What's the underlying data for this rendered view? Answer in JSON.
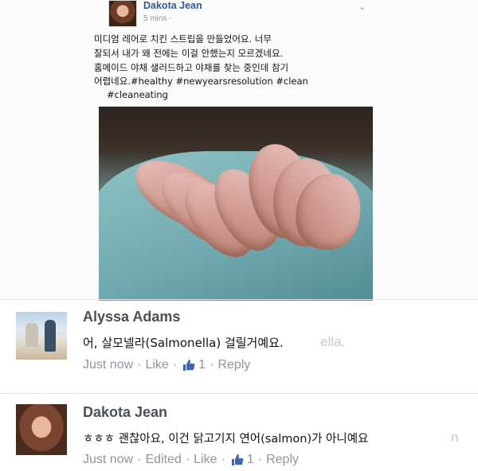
{
  "post": {
    "author": "Dakota Jean",
    "time": "5 mins ·",
    "text_line1": "미디엄 레어로 치킨 스트립을 만들었어요. 너무",
    "text_line2": "잘되서 내가 왜 전에는 이걸 안했는지 모르겠네요.",
    "text_line3": "홈메이드 야채 샐러드하고 야채를 찾는 중인데 참기",
    "text_line4": "어렵네요.#healthy #newyearsresolution #clean",
    "text_line5": "#cleaneating"
  },
  "comments": [
    {
      "name": "Alyssa Adams",
      "text": "어, 살모넬라(Salmonella) 걸릴거예요.",
      "ghost": "ella.",
      "time": "Just now",
      "like": "Like",
      "like_count": "1",
      "reply": "Reply"
    },
    {
      "name": "Dakota Jean",
      "text": "ㅎㅎㅎ 괜찮아요, 이건 닭고기지 연어(salmon)가 아니예요",
      "ghost": "n",
      "time": "Just now",
      "edited": "Edited",
      "like": "Like",
      "like_count": "1",
      "reply": "Reply"
    }
  ],
  "colors": {
    "link": "#365899",
    "meta": "#90949c",
    "like_blue": "#4267b2"
  },
  "icons": {
    "like": "thumbs-up-icon"
  }
}
